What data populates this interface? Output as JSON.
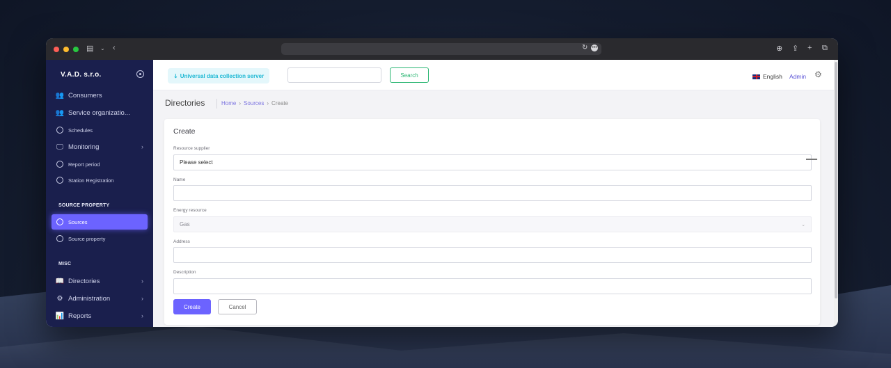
{
  "brand": {
    "name": "V.A.D. s.r.o."
  },
  "sidebar": {
    "items": [
      {
        "label": "Consumers",
        "icon": "users-icon"
      },
      {
        "label": "Service organizatio...",
        "icon": "users-icon"
      },
      {
        "label": "Schedules",
        "icon": "circle-icon"
      },
      {
        "label": "Monitoring",
        "icon": "monitor-icon"
      },
      {
        "label": "Report period",
        "icon": "circle-icon"
      },
      {
        "label": "Station Registration",
        "icon": "circle-icon"
      }
    ],
    "section_source": "SOURCE PROPERTY",
    "source_items": [
      {
        "label": "Sources",
        "icon": "circle-icon",
        "active": true
      },
      {
        "label": "Source property",
        "icon": "circle-icon"
      }
    ],
    "section_misc": "MISC",
    "misc_items": [
      {
        "label": "Directories",
        "icon": "book-icon"
      },
      {
        "label": "Administration",
        "icon": "gear-icon"
      },
      {
        "label": "Reports",
        "icon": "bar-chart-icon"
      }
    ]
  },
  "topbar": {
    "server_label": "Universal data collection server",
    "search_button": "Search",
    "language": "English",
    "user": "Admin"
  },
  "page": {
    "title": "Directories",
    "breadcrumb": [
      "Home",
      "Sources",
      "Create"
    ]
  },
  "form": {
    "title": "Create",
    "resource_supplier_label": "Resource supplier",
    "resource_supplier_value": "Please select",
    "name_label": "Name",
    "name_value": "",
    "energy_resource_label": "Energy resource",
    "energy_resource_value": "Gas",
    "address_label": "Address",
    "address_value": "",
    "description_label": "Description",
    "description_value": "",
    "create_button": "Create",
    "cancel_button": "Cancel"
  },
  "colors": {
    "sidebar_bg": "#1a1f4d",
    "accent": "#6c63ff",
    "search_green": "#2bb673",
    "server_cyan": "#1eb8d4"
  }
}
